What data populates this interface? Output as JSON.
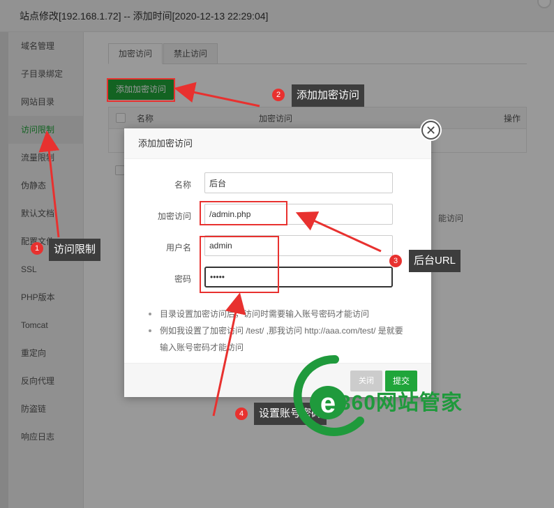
{
  "window": {
    "title": "站点修改[192.168.1.72] -- 添加时间[2020-12-13 22:29:04]"
  },
  "sidebar": {
    "items": [
      {
        "label": "域名管理"
      },
      {
        "label": "子目录绑定"
      },
      {
        "label": "网站目录"
      },
      {
        "label": "访问限制"
      },
      {
        "label": "流量限制"
      },
      {
        "label": "伪静态"
      },
      {
        "label": "默认文档"
      },
      {
        "label": "配置文件"
      },
      {
        "label": "SSL"
      },
      {
        "label": "PHP版本"
      },
      {
        "label": "Tomcat"
      },
      {
        "label": "重定向"
      },
      {
        "label": "反向代理"
      },
      {
        "label": "防盗链"
      },
      {
        "label": "响应日志"
      }
    ],
    "active_index": 3
  },
  "main": {
    "tabs": [
      {
        "label": "加密访问"
      },
      {
        "label": "禁止访问"
      }
    ],
    "add_button": "添加加密访问",
    "table": {
      "columns": [
        "名称",
        "加密访问",
        "操作"
      ]
    },
    "background_tip_fragment": "能访问"
  },
  "dialog": {
    "title": "添加加密访问",
    "fields": {
      "name_label": "名称",
      "name_value": "后台",
      "path_label": "加密访问",
      "path_value": "/admin.php",
      "user_label": "用户名",
      "user_value": "admin",
      "pass_label": "密码",
      "pass_value": "•••••"
    },
    "tips": [
      "目录设置加密访问后，访问时需要输入账号密码才能访问",
      "例如我设置了加密访问 /test/ ,那我访问 http://aaa.com/test/ 是就要输入账号密码才能访问"
    ],
    "close_button": "关闭",
    "submit_button": "提交"
  },
  "annotations": {
    "badge1": "1",
    "callout1": "访问限制",
    "badge2": "2",
    "callout2": "添加加密访问",
    "badge3": "3",
    "callout3": "后台URL",
    "badge4": "4",
    "callout4": "设置账号密码"
  },
  "watermark": {
    "text": "360网站管家"
  },
  "colors": {
    "accent": "#20a53a",
    "annotation_red": "#e8312f",
    "callout_bg": "#3d3d3d"
  }
}
